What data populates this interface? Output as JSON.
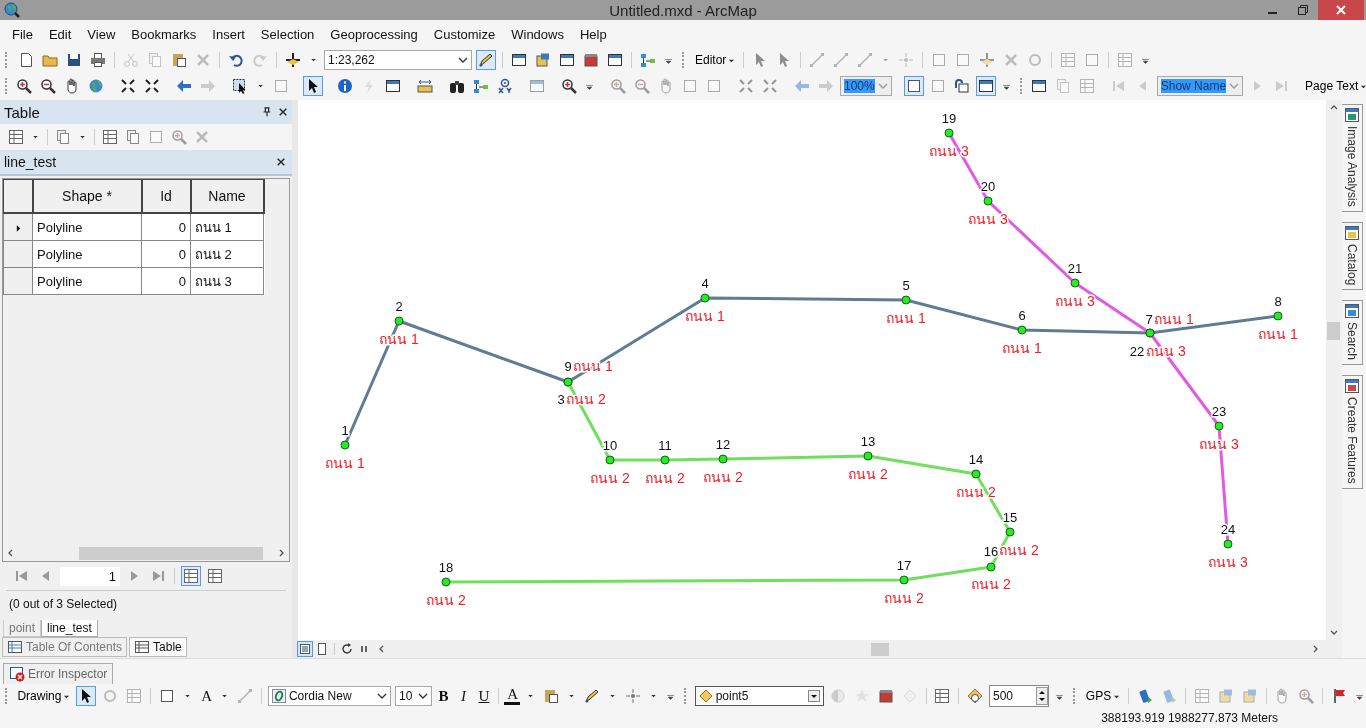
{
  "window": {
    "title": "Untitled.mxd - ArcMap"
  },
  "menu": [
    "File",
    "Edit",
    "View",
    "Bookmarks",
    "Insert",
    "Selection",
    "Geoprocessing",
    "Customize",
    "Windows",
    "Help"
  ],
  "standard_toolbar": {
    "scale": "1:23,262",
    "editor": "Editor"
  },
  "layout_toolbar": {
    "zoom": "100%",
    "page": "Show Name",
    "page_text": "Page Text"
  },
  "table_window": {
    "title": "Table",
    "table_name": "line_test",
    "columns": [
      "Shape *",
      "Id",
      "Name"
    ],
    "rows": [
      {
        "cells": [
          "Polyline",
          "0",
          "ถนน 1"
        ],
        "current": true
      },
      {
        "cells": [
          "Polyline",
          "0",
          "ถนน 2"
        ],
        "current": false
      },
      {
        "cells": [
          "Polyline",
          "0",
          "ถนน 3"
        ],
        "current": false
      }
    ],
    "record": "1",
    "status": "(0 out of 3 Selected)",
    "table_tabs": [
      {
        "label": "point",
        "selected": false
      },
      {
        "label": "line_test",
        "selected": true
      }
    ]
  },
  "dock_tabs": [
    {
      "label": "Table Of Contents",
      "selected": false
    },
    {
      "label": "Table",
      "selected": true
    }
  ],
  "right_dock": [
    "Image Analysis",
    "Catalog",
    "Search",
    "Create Features"
  ],
  "error_inspector": "Error Inspector",
  "drawing_toolbar": {
    "label": "Drawing",
    "text_tool": "A",
    "font": "Cordia New",
    "size": "10",
    "bold": "B",
    "italic": "I",
    "underline": "U",
    "font_color": "A"
  },
  "editing": {
    "template": "point5",
    "value": "500",
    "gps": "GPS"
  },
  "status_bar": {
    "coordinates": "388193.919  1988277.873 Meters"
  },
  "map": {
    "roads": [
      {
        "color": "#5f7c94"
      },
      {
        "color": "#6ee05c"
      },
      {
        "color": "#e05ae4"
      }
    ],
    "points": [
      {
        "number": "1",
        "label": "ถนน 1"
      },
      {
        "number": "2",
        "label": "ถนน 1"
      },
      {
        "number": "3",
        "label": "ถนน 2"
      },
      {
        "number": "4",
        "label": "ถนน 1"
      },
      {
        "number": "5",
        "label": "ถนน 1"
      },
      {
        "number": "6",
        "label": "ถนน 1"
      },
      {
        "number": "7",
        "label": "ถนน 1"
      },
      {
        "number": "8",
        "label": "ถนน 1"
      },
      {
        "number": "9",
        "label": "ถนน 1"
      },
      {
        "number": "10",
        "label": "ถนน 2"
      },
      {
        "number": "11",
        "label": "ถนน 2"
      },
      {
        "number": "12",
        "label": "ถนน 2"
      },
      {
        "number": "13",
        "label": "ถนน 2"
      },
      {
        "number": "14",
        "label": "ถนน 2"
      },
      {
        "number": "15",
        "label": "ถนน 2"
      },
      {
        "number": "16",
        "label": "ถนน 2"
      },
      {
        "number": "18",
        "label": "ถนน 2"
      },
      {
        "number": "17",
        "label": "ถนน 2"
      },
      {
        "number": "19",
        "label": "ถนน 3"
      },
      {
        "number": "20",
        "label": "ถนน 3"
      },
      {
        "number": "21",
        "label": "ถนน 3"
      },
      {
        "number": "22",
        "label": "ถนน 3"
      },
      {
        "number": "23",
        "label": "ถนน 3"
      },
      {
        "number": "24",
        "label": "ถนน 3"
      }
    ]
  }
}
